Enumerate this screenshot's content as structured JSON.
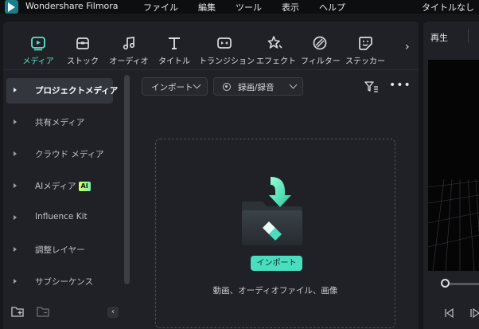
{
  "titlebar": {
    "app_name": "Wondershare Filmora",
    "menu": [
      "ファイル",
      "編集",
      "ツール",
      "表示",
      "ヘルプ"
    ],
    "document_title": "タイトルなし"
  },
  "tabs": [
    {
      "label": "メディア",
      "icon": "media-icon",
      "active": true
    },
    {
      "label": "ストック",
      "icon": "stock-icon",
      "active": false
    },
    {
      "label": "オーディオ",
      "icon": "audio-icon",
      "active": false
    },
    {
      "label": "タイトル",
      "icon": "title-icon",
      "active": false
    },
    {
      "label": "トランジション",
      "icon": "transition-icon",
      "active": false
    },
    {
      "label": "エフェクト",
      "icon": "effect-icon",
      "active": false
    },
    {
      "label": "フィルター",
      "icon": "filter-tab-icon",
      "active": false
    },
    {
      "label": "ステッカー",
      "icon": "sticker-icon",
      "active": false
    }
  ],
  "sidebar": {
    "items": [
      {
        "label": "プロジェクトメディア",
        "active": true
      },
      {
        "label": "共有メディア",
        "active": false
      },
      {
        "label": "クラウド メディア",
        "active": false
      },
      {
        "label": "AIメディア",
        "badge": "AI",
        "active": false
      },
      {
        "label": "Influence Kit",
        "active": false
      },
      {
        "label": "調整レイヤー",
        "active": false
      },
      {
        "label": "サブシーケンス",
        "active": false
      }
    ]
  },
  "toolbar": {
    "import_label": "インポート",
    "record_label": "録画/録音"
  },
  "dropzone": {
    "import_button": "インポート",
    "hint": "動画、オーディオファイル、画像"
  },
  "preview": {
    "play_label": "再生"
  },
  "colors": {
    "accent": "#49dec0",
    "panel": "#1f2126",
    "background": "#16171b"
  }
}
